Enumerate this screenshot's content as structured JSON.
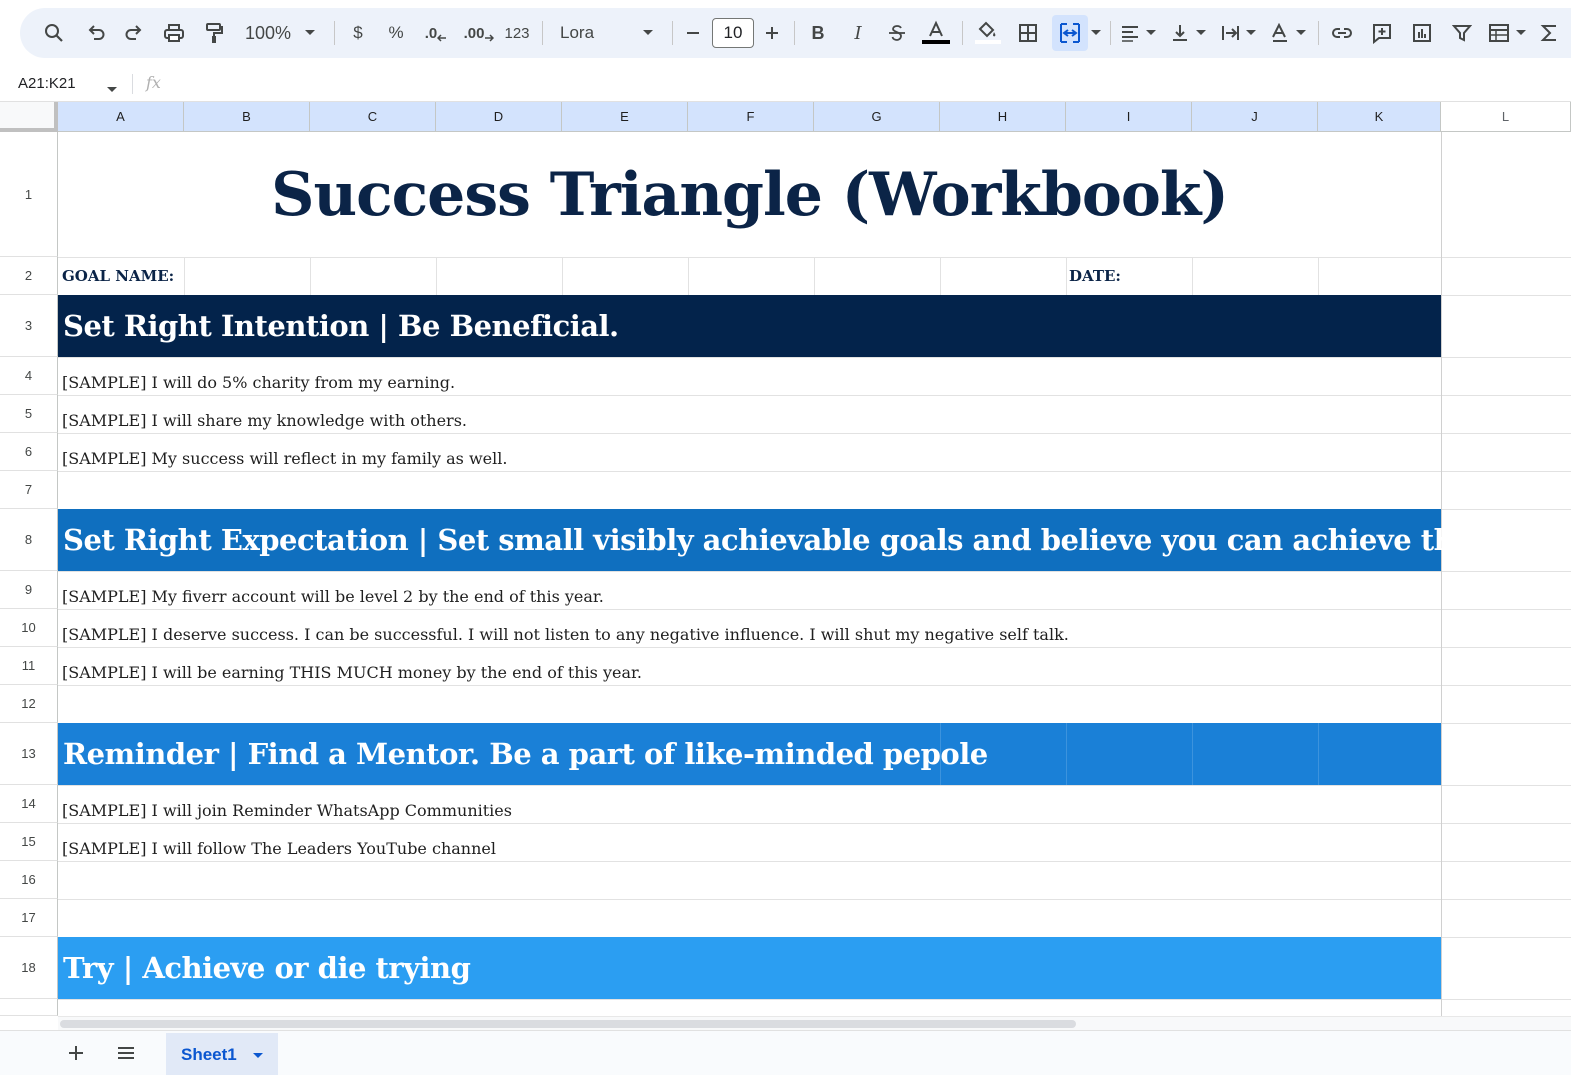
{
  "toolbar": {
    "zoom": "100%",
    "currency_symbol": "$",
    "percent_symbol": "%",
    "decrease_decimal": ".0",
    "increase_decimal": ".00",
    "more_formats": "123",
    "font_name": "Lora",
    "font_size": "10",
    "bold": "B",
    "italic": "I"
  },
  "formula_bar": {
    "name_box": "A21:K21",
    "fx_label": "fx",
    "value": ""
  },
  "columns": [
    "A",
    "B",
    "C",
    "D",
    "E",
    "F",
    "G",
    "H",
    "I",
    "J",
    "K",
    "L"
  ],
  "rows": [
    "1",
    "2",
    "3",
    "4",
    "5",
    "6",
    "7",
    "8",
    "9",
    "10",
    "11",
    "12",
    "13",
    "14",
    "15",
    "16",
    "17",
    "18"
  ],
  "sheet": {
    "title": "Success Triangle (Workbook)",
    "goal_label": "GOAL NAME:",
    "date_label": "DATE:",
    "sections": [
      {
        "heading": "Set Right Intention | Be Beneficial.",
        "items": [
          "[SAMPLE] I will do 5% charity from my earning.",
          "[SAMPLE] I will share my knowledge with others.",
          "[SAMPLE] My success will reflect in my family as well."
        ]
      },
      {
        "heading": "Set Right Expectation | Set small visibly achievable goals and believe you can achieve them.",
        "items": [
          "[SAMPLE] My fiverr account will be level 2 by the end of this year.",
          "[SAMPLE] I deserve success. I can be successful. I will not listen to any negative influence. I will shut my negative self talk.",
          "[SAMPLE] I will be earning THIS MUCH money by the end of this year."
        ]
      },
      {
        "heading": "Reminder | Find a Mentor. Be a part of like-minded pepole",
        "items": [
          "[SAMPLE] I will join Reminder WhatsApp Communities",
          "[SAMPLE] I will follow The Leaders YouTube channel"
        ]
      },
      {
        "heading": "Try | Achieve or die trying",
        "items": []
      }
    ]
  },
  "tabs": {
    "active_sheet": "Sheet1"
  },
  "colors": {
    "title": "#0b2447",
    "band_1": "#03234b",
    "band_2": "#0f6fbf",
    "band_3": "#1a80d7",
    "band_4": "#2b9ef2",
    "selection": "#d3e3fd"
  }
}
